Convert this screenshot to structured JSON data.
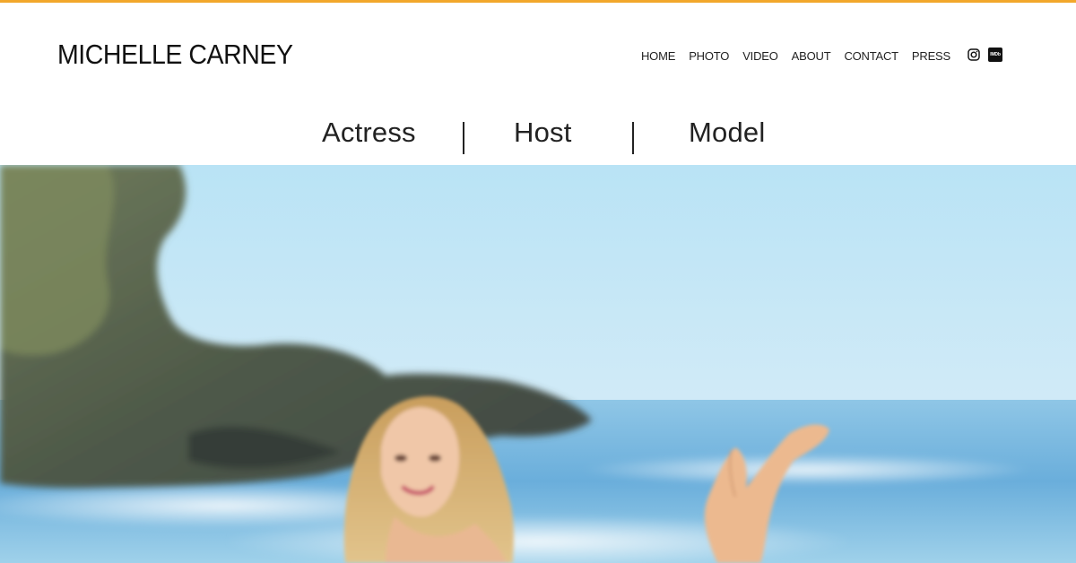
{
  "site": {
    "title": "MICHELLE CARNEY",
    "accent_color": "#f2a72b"
  },
  "nav": {
    "items": [
      {
        "label": "HOME"
      },
      {
        "label": "PHOTO"
      },
      {
        "label": "VIDEO"
      },
      {
        "label": "ABOUT"
      },
      {
        "label": "CONTACT"
      },
      {
        "label": "PRESS"
      }
    ]
  },
  "social": {
    "instagram_icon": "instagram-icon",
    "imdb_icon": "imdb-icon",
    "imdb_text": "IMDb"
  },
  "roles": {
    "first": "Actress",
    "second": "Host",
    "third": "Model"
  },
  "hero": {
    "icon": "beach-photo"
  }
}
